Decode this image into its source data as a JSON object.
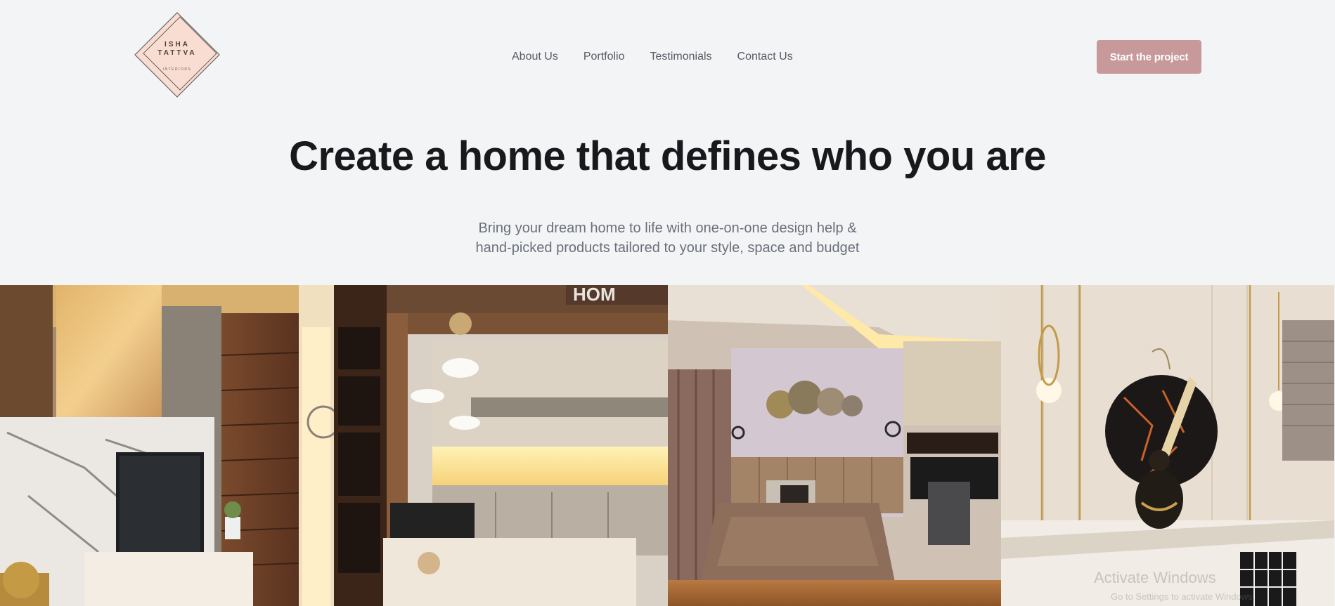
{
  "brand": {
    "logo_line1": "ISHA",
    "logo_line2": "TATTVA",
    "logo_sub": "INTERIORS",
    "accent_color": "#c8999a",
    "logo_bg": "#f9dcd2"
  },
  "nav": {
    "items": [
      {
        "label": "About Us"
      },
      {
        "label": "Portfolio"
      },
      {
        "label": "Testimonials"
      },
      {
        "label": "Contact Us"
      }
    ],
    "cta_label": "Start the project"
  },
  "hero": {
    "title": "Create a home that defines who you are",
    "subtitle_line1": "Bring your dream home to life with one-on-one design help &",
    "subtitle_line2": "hand-picked products tailored to your style, space and budget"
  },
  "gallery": {
    "images": [
      {
        "name": "living-room-tv-unit-image"
      },
      {
        "name": "kitchen-image"
      },
      {
        "name": "bedroom-image"
      },
      {
        "name": "foyer-mirror-image"
      }
    ]
  },
  "overlay": {
    "watermark_line1": "Activate Windows",
    "watermark_line2": "Go to Settings to activate Windows."
  }
}
